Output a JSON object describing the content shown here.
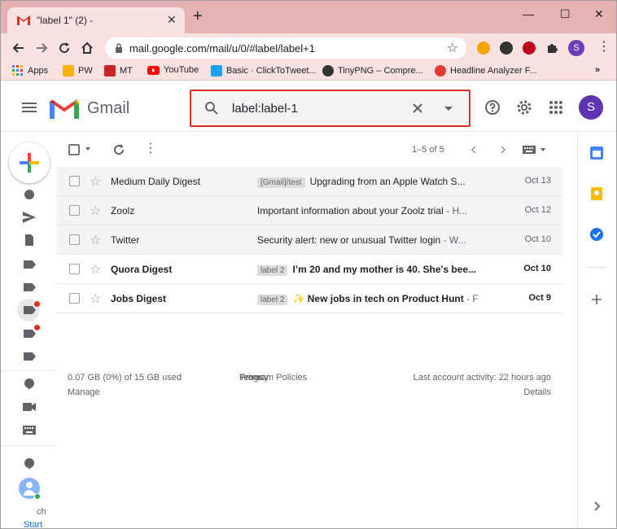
{
  "browser": {
    "tab_title": "\"label 1\" (2) -",
    "tab_close": "✕",
    "new_tab": "+",
    "window_controls": {
      "minimize": "—",
      "maximize": "☐",
      "close": "✕"
    },
    "url": "mail.google.com/mail/u/0/#label/label+1",
    "profile_letter": "S",
    "bookmarks": [
      {
        "label": "Apps",
        "icon": "apps-grid-icon",
        "color": "#4285f4"
      },
      {
        "label": "PW",
        "icon": "pw-icon",
        "color": "#f4b400"
      },
      {
        "label": "MT",
        "icon": "mt-icon",
        "color": "#c62828"
      },
      {
        "label": "YouTube",
        "icon": "youtube-icon",
        "color": "#ff0000"
      },
      {
        "label": "Basic · ClickToTweet...",
        "icon": "clicktotweet-icon",
        "color": "#1da1f2"
      },
      {
        "label": "TinyPNG – Compre...",
        "icon": "tinypng-icon",
        "color": "#333333"
      },
      {
        "label": "Headline Analyzer F...",
        "icon": "headline-analyzer-icon",
        "color": "#e53935"
      }
    ],
    "bookmarks_overflow": "»"
  },
  "gmail": {
    "product_name": "Gmail",
    "search_value": "label:label-1",
    "avatar_letter": "S"
  },
  "toolbar": {
    "pager": "1–5 of 5"
  },
  "emails": [
    {
      "sender": "Medium Daily Digest",
      "label": "[Gmail]/test",
      "subject": "Upgrading from an Apple Watch S...",
      "snippet": "",
      "date": "Oct 13",
      "unread": false
    },
    {
      "sender": "Zoolz",
      "label": "",
      "subject": "Important information about your Zoolz trial",
      "snippet": " - H...",
      "date": "Oct 12",
      "unread": false
    },
    {
      "sender": "Twitter",
      "label": "",
      "subject": "Security alert: new or unusual Twitter login",
      "snippet": " - W...",
      "date": "Oct 10",
      "unread": false
    },
    {
      "sender": "Quora Digest",
      "label": "label 2",
      "subject": "I’m 20 and my mother is 40. She's bee...",
      "snippet": "",
      "date": "Oct 10",
      "unread": true
    },
    {
      "sender": "Jobs Digest",
      "label": "label 2",
      "subject": "✨ New jobs in tech on Product Hunt",
      "snippet": " - F",
      "date": "Oct 9",
      "unread": true
    }
  ],
  "footer": {
    "storage": "0.07 GB (0%) of 15 GB used",
    "manage": "Manage",
    "terms": "Terms",
    "privacy": "Privacy",
    "policies": "Program Policies",
    "sep": " · ",
    "last_activity": "Last account activity: 22 hours ago",
    "details": "Details"
  },
  "leftnav_bottom": {
    "text1": "ch",
    "text2": "Start"
  },
  "colors": {
    "titlebar": "#e6b1b3",
    "toolbar": "#f7e1e1",
    "search_border": "#d93025",
    "avatar": "#5e35b1"
  }
}
